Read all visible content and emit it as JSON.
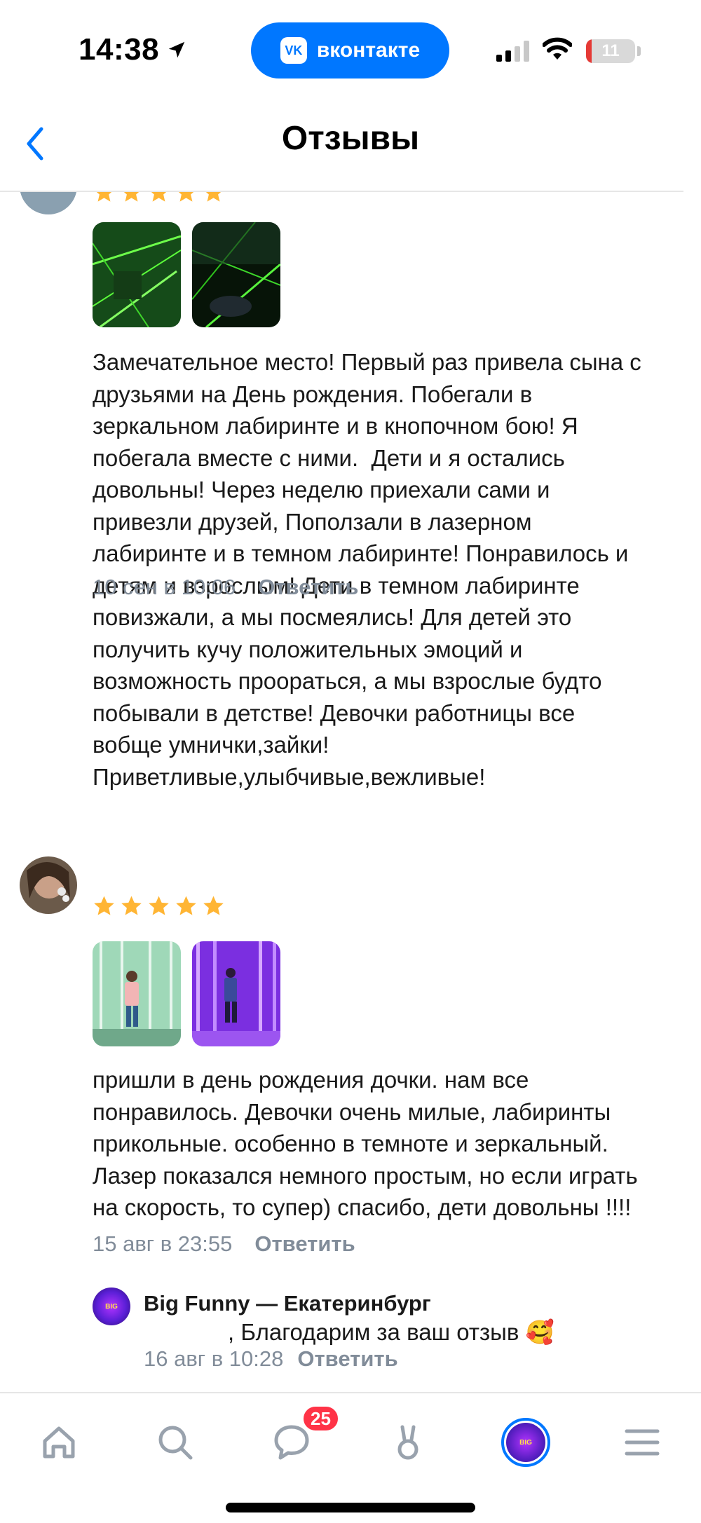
{
  "status_bar": {
    "time": "14:38",
    "app_pill_label": "вконтакте",
    "app_pill_logo": "vk",
    "battery_percent": "11",
    "battery_level": 0.11
  },
  "header": {
    "title": "Отзывы"
  },
  "reviews": [
    {
      "rating": 5,
      "text": "Замечательное место! Первый раз привела сына с\nдрузьями на День рождения. Побегали в\nзеркальном лабиринте и в кнопочном бою! Я\nпобегала вместе с ними.  Дети и я остались\nдовольны! Через неделю приехали сами и\nпривезли друзей, Поползали в лазерном\nлабиринте и в темном лабиринте! Понравилось и\nдетям и взрослым! Дети в темном лабиринте\nповизжали, а мы посмеялись! Для детей это\nполучить кучу положительных эмоций и\nвозможность проораться, а мы взрослые будто\nпобывали в детстве! Девочки работницы все\nвобще умнички,зайки!\nПриветливые,улыбчивые,вежливые!",
      "date": "10 сен в 10:06",
      "reply_label": "Ответить"
    },
    {
      "rating": 5,
      "text": "пришли в день рождения дочки. нам все\nпонравилось. Девочки очень милые, лабиринты\nприкольные. особенно в темноте и зеркальный.\nЛазер показался немного простым, но если играть\nна скорость, то супер) спасибо, дети довольны !!!!",
      "date": "15 авг в 23:55",
      "reply_label": "Ответить",
      "reply": {
        "author": "Big Funny — Екатеринбург",
        "text": ", Благодарим за ваш отзыв 🥰",
        "date": "16 авг в 10:28",
        "reply_label": "Ответить"
      }
    }
  ],
  "tab_bar": {
    "messages_badge": "25",
    "items": [
      "home-icon",
      "search-icon",
      "messages-icon",
      "services-icon",
      "profile-icon",
      "menu-icon"
    ]
  },
  "colors": {
    "accent": "#0077ff",
    "star": "#ffb534",
    "badge": "#ff3347",
    "meta": "#818c99"
  }
}
